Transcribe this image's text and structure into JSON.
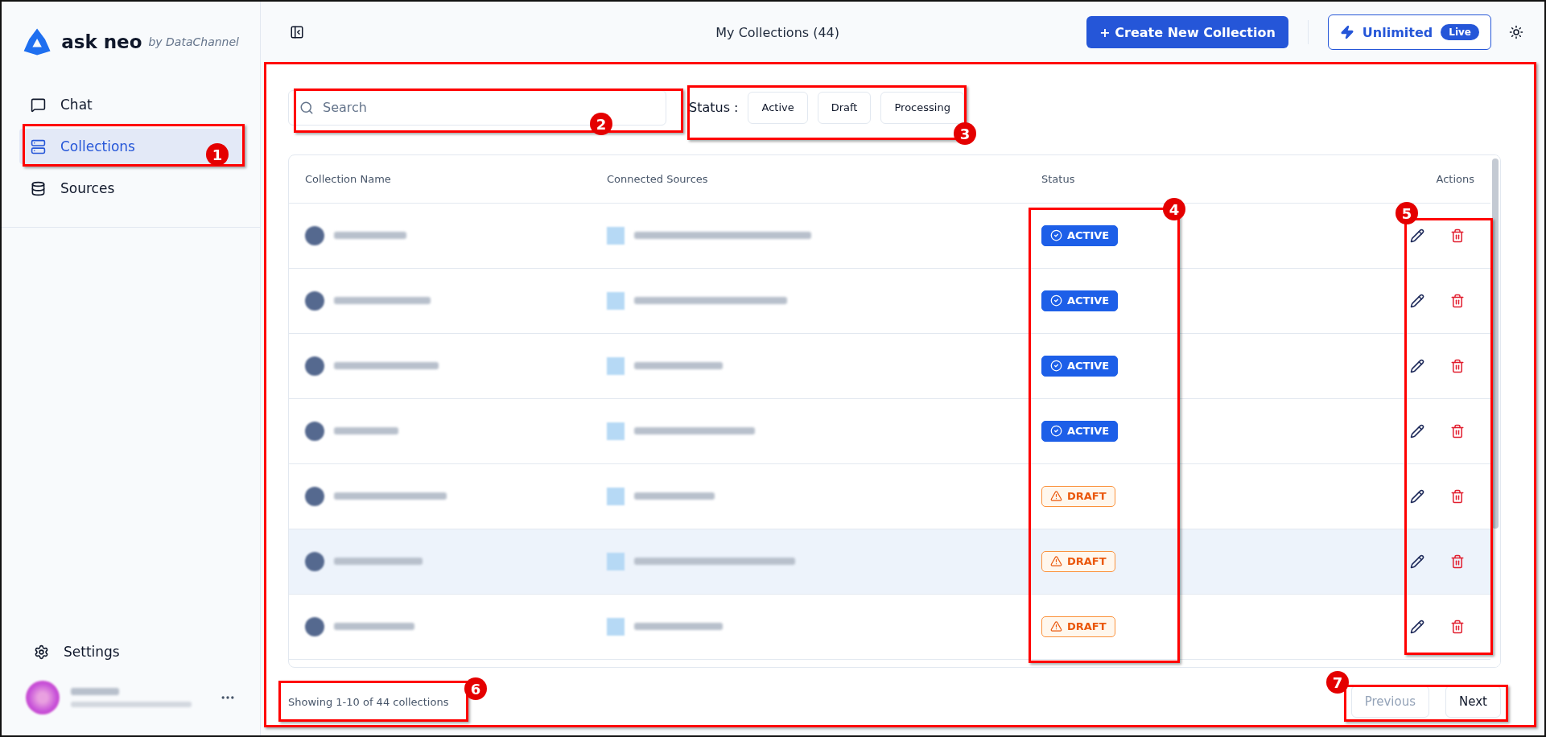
{
  "brand": {
    "name": "ask neo",
    "byline": "by DataChannel"
  },
  "sidebar": {
    "items": [
      {
        "label": "Chat",
        "selected": false
      },
      {
        "label": "Collections",
        "selected": true
      },
      {
        "label": "Sources",
        "selected": false
      }
    ],
    "settings": "Settings"
  },
  "header": {
    "title": "My Collections (44)",
    "create_button": "+ Create New Collection",
    "plan": "Unlimited",
    "plan_badge": "Live"
  },
  "search": {
    "placeholder": "Search"
  },
  "filters": {
    "label": "Status :",
    "options": [
      {
        "label": "Active",
        "selected": false
      },
      {
        "label": "Draft",
        "selected": false
      },
      {
        "label": "Processing",
        "selected": false
      }
    ]
  },
  "table": {
    "columns": [
      "Collection Name",
      "Connected Sources",
      "Status",
      "Actions"
    ],
    "rows": [
      {
        "status": "ACTIVE",
        "kind": "active",
        "highlighted": false
      },
      {
        "status": "ACTIVE",
        "kind": "active",
        "highlighted": false
      },
      {
        "status": "ACTIVE",
        "kind": "active",
        "highlighted": false
      },
      {
        "status": "ACTIVE",
        "kind": "active",
        "highlighted": false
      },
      {
        "status": "DRAFT",
        "kind": "draft",
        "highlighted": false
      },
      {
        "status": "DRAFT",
        "kind": "draft",
        "highlighted": true
      },
      {
        "status": "DRAFT",
        "kind": "draft",
        "highlighted": false
      }
    ]
  },
  "footer": {
    "summary": "Showing 1-10 of 44 collections",
    "previous": {
      "label": "Previous",
      "disabled": true
    },
    "next": {
      "label": "Next",
      "disabled": false
    }
  },
  "annotations": [
    {
      "label": "1"
    },
    {
      "label": "2"
    },
    {
      "label": "3"
    },
    {
      "label": "4"
    },
    {
      "label": "5"
    },
    {
      "label": "6"
    },
    {
      "label": "7"
    }
  ]
}
